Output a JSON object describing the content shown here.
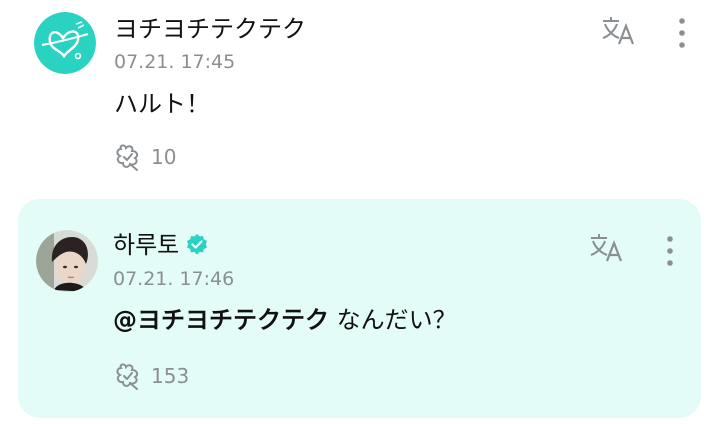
{
  "post": {
    "author": "ヨチヨチテクテク",
    "timestamp": "07.21. 17:45",
    "text": "ハルト！",
    "likes": "10",
    "avatar_icon": "butterfly-logo-avatar",
    "translate_icon": "translate-icon",
    "more_icon": "more-vertical-icon"
  },
  "reply": {
    "author": "하루토",
    "verified_icon": "verified-badge-icon",
    "timestamp": "07.21. 17:46",
    "mention": "@ヨチヨチテクテク",
    "text": " なんだい？",
    "likes": "153",
    "avatar_icon": "profile-photo-avatar",
    "translate_icon": "translate-icon",
    "more_icon": "more-vertical-icon"
  },
  "colors": {
    "reply_background": "#e4fcf7",
    "accent": "#2ad3c1",
    "muted_text": "#8a8f93"
  }
}
